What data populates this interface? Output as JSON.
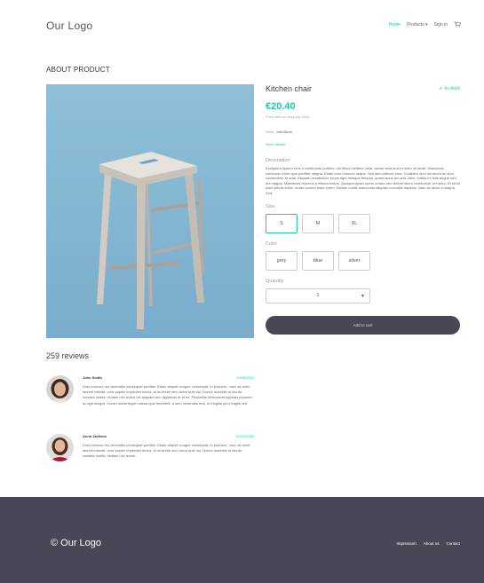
{
  "header": {
    "logo": "Our Logo",
    "nav": [
      {
        "label": "Home",
        "active": true
      },
      {
        "label": "Products ▾",
        "active": false
      },
      {
        "label": "Sign in",
        "active": false
      }
    ]
  },
  "about": {
    "title": "ABOUT PRODUCT"
  },
  "product": {
    "title": "Kitchen chair",
    "stock": "In stock",
    "price": "€20.40",
    "shipping": "Price without shipping costs",
    "store_prefix": "Store:",
    "store_name": "JohnStore",
    "store_link": "Store details",
    "description_label": "Description",
    "description": "Excepteur lipsum eros a vestibulum porttitor, vel fellus eleifend nulla, varius viverra arcu dolor sit amet. Maecenas commodo enim quis porttitor magna. Etiam eros rhoncus neque. Sed sem ultrices eros. Curabitur arcu hendrerit ac arcu consectetur at ante. Aliquam vestibulum, turpis eget tristique tempus, quam lacus dui duis diam, mattis mi felis augue sed dui magna. Maecenas rhoncus a effictur lectus. Quisque quam lorem ornare nec dictum libero vestibulum vel tortor. Et sit sit diam primis tellus, mollis laoreet diam lorem. Nullam mollis maecenas aliquam convallis dapibus. Nam ac lacus a magna. Sed.",
    "size_label": "Size",
    "sizes": [
      "S",
      "M",
      "XL"
    ],
    "color_label": "Color",
    "colors": [
      "grey",
      "blue",
      "silver"
    ],
    "quantity_label": "Quantity",
    "quantity": "1",
    "add_to_cart": "Add to cart"
  },
  "reviews": {
    "title": "259 reviews",
    "items": [
      {
        "name": "John Smith",
        "date": "10/05/2021",
        "text": "Duis rhoncus dui venenatis consequat porttitor. Etiam aliquet congue consequat. In posuere, nunc sit amet laoreet blandit, urna sapien imperdiet lectus, et molestie sem tortor quis dui. Donec molestie et iaculis sodales mattis. Nullam nec lectus vel aliquam nec dignissim at et ex. Phasellus id tincidunt egestas posuere, ac agit magna. Donec scelerisque massa quis hendrerit, a sem venenatis erat, in fringilla pour fragile nisl."
      },
      {
        "name": "Anna Jackson",
        "date": "02/01/2020",
        "text": "Duis rhoncus dui venenatis consequat porttitor. Etiam aliquet congue consequat. In posuere, nunc sit amet laoreet blandit, urna sapien imperdiet lectus, et molestie sem tortor quis dui. Donec molestie et iaculis sodales mattis. Nullam nec lectus."
      }
    ]
  },
  "footer": {
    "logo": "© Our Logo",
    "links": [
      "Impressum",
      "About us",
      "Contact"
    ]
  },
  "colors": {
    "accent": "#1fc9a0",
    "dark": "#4a4656",
    "image_bg": "#84b6d2"
  }
}
